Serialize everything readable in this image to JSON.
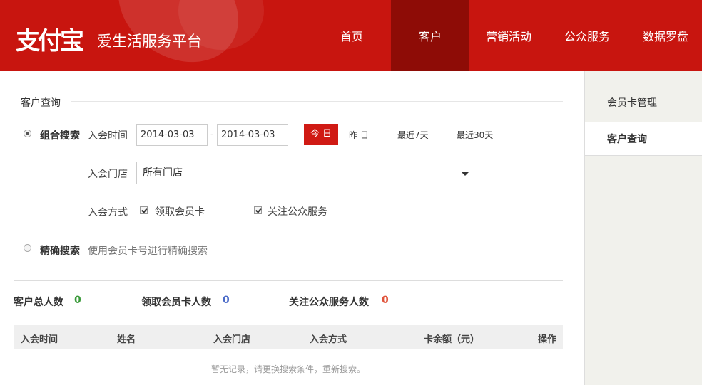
{
  "header": {
    "logo_mark": "支付宝",
    "logo_sub": "爱生活服务平台",
    "nav": [
      {
        "label": "首页"
      },
      {
        "label": "客户"
      },
      {
        "label": "营销活动"
      },
      {
        "label": "公众服务"
      },
      {
        "label": "数据罗盘"
      }
    ],
    "active_nav": "客户"
  },
  "sidebar": {
    "items": [
      {
        "label": "会员卡管理"
      },
      {
        "label": "客户查询"
      }
    ],
    "active_item": "客户查询"
  },
  "search": {
    "section_title": "客户查询",
    "combined": {
      "label": "组合搜索",
      "selected": true,
      "join_time_label": "入会时间",
      "date_from": "2014-03-03",
      "date_to": "2014-03-03",
      "date_sep": "-",
      "quick_ranges": [
        "今 日",
        "昨 日",
        "最近7天",
        "最近30天"
      ],
      "store_label": "入会门店",
      "store_value": "所有门店",
      "method_label": "入会方式",
      "methods": [
        {
          "label": "领取会员卡",
          "checked": true
        },
        {
          "label": "关注公众服务",
          "checked": true
        }
      ]
    },
    "exact": {
      "label": "精确搜索",
      "selected": false,
      "hint": "使用会员卡号进行精确搜索"
    }
  },
  "stats": [
    {
      "label": "客户总人数",
      "value": "0",
      "color": "#3a9a3a"
    },
    {
      "label": "领取会员卡人数",
      "value": "0",
      "color": "#4a6ac8"
    },
    {
      "label": "关注公众服务人数",
      "value": "0",
      "color": "#e0533a"
    }
  ],
  "table": {
    "columns": [
      "入会时间",
      "姓名",
      "入会门店",
      "入会方式",
      "卡余额（元）",
      "操作"
    ],
    "empty_text": "暂无记录，请更换搜索条件，重新搜索。"
  }
}
